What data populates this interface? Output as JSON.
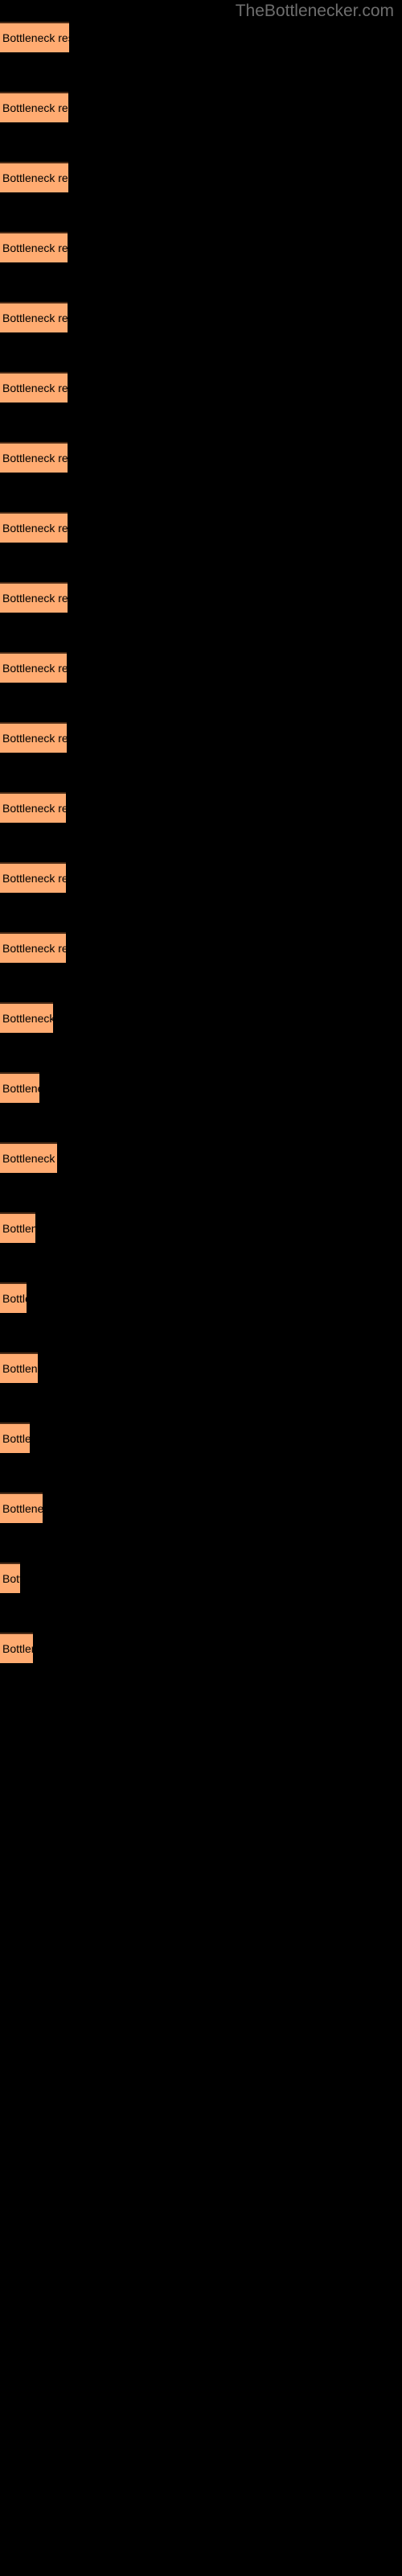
{
  "site": {
    "title": "TheBottlenecker.com",
    "title_color": "#6e6e6e"
  },
  "theme": {
    "background": "#000000",
    "bar_fill": "#ffab71",
    "bar_border_top": "#4a2b16",
    "label_color": "#000000"
  },
  "chart_data": {
    "type": "bar",
    "orientation": "horizontal",
    "title": "",
    "xlabel": "",
    "ylabel": "",
    "grid": false,
    "legend": null,
    "bar_label_text": "Bottleneck result",
    "categories": [
      "Bottleneck result",
      "Bottleneck result",
      "Bottleneck result",
      "Bottleneck result",
      "Bottleneck result",
      "Bottleneck result",
      "Bottleneck result",
      "Bottleneck result",
      "Bottleneck result",
      "Bottleneck result",
      "Bottleneck result",
      "Bottleneck result",
      "Bottleneck result",
      "Bottleneck result",
      "Bottleneck result",
      "Bottleneck result",
      "Bottleneck result",
      "Bottleneck result",
      "Bottleneck result",
      "Bottleneck result",
      "Bottleneck result",
      "Bottleneck result",
      "Bottleneck result"
    ],
    "values": [
      85,
      84,
      84,
      83,
      83,
      83,
      83,
      83,
      83,
      82,
      82,
      81,
      81,
      81,
      65,
      48,
      70,
      43,
      32,
      46,
      36,
      52,
      24,
      40
    ],
    "xlim": [
      0,
      500
    ]
  },
  "bars": [
    {
      "label": "Bottleneck result",
      "y": 27,
      "width": 86
    },
    {
      "label": "Bottleneck result",
      "y": 114,
      "width": 85
    },
    {
      "label": "Bottleneck result",
      "y": 201,
      "width": 85
    },
    {
      "label": "Bottleneck result",
      "y": 288,
      "width": 84
    },
    {
      "label": "Bottleneck result",
      "y": 375,
      "width": 84
    },
    {
      "label": "Bottleneck result",
      "y": 462,
      "width": 84
    },
    {
      "label": "Bottleneck result",
      "y": 549,
      "width": 84
    },
    {
      "label": "Bottleneck result",
      "y": 636,
      "width": 84
    },
    {
      "label": "Bottleneck result",
      "y": 723,
      "width": 84
    },
    {
      "label": "Bottleneck result",
      "y": 810,
      "width": 83
    },
    {
      "label": "Bottleneck result",
      "y": 897,
      "width": 83
    },
    {
      "label": "Bottleneck result",
      "y": 984,
      "width": 82
    },
    {
      "label": "Bottleneck result",
      "y": 1071,
      "width": 82
    },
    {
      "label": "Bottleneck result",
      "y": 1158,
      "width": 82
    },
    {
      "label": "Bottleneck result",
      "y": 1245,
      "width": 66
    },
    {
      "label": "Bottleneck result",
      "y": 1332,
      "width": 49
    },
    {
      "label": "Bottleneck result",
      "y": 1419,
      "width": 71
    },
    {
      "label": "Bottleneck result",
      "y": 1506,
      "width": 44
    },
    {
      "label": "Bottleneck result",
      "y": 1593,
      "width": 33
    },
    {
      "label": "Bottleneck result",
      "y": 1680,
      "width": 47
    },
    {
      "label": "Bottleneck result",
      "y": 1767,
      "width": 37
    },
    {
      "label": "Bottleneck result",
      "y": 1854,
      "width": 53
    },
    {
      "label": "Bottleneck result",
      "y": 1941,
      "width": 25
    },
    {
      "label": "Bottleneck result",
      "y": 2028,
      "width": 41
    }
  ]
}
